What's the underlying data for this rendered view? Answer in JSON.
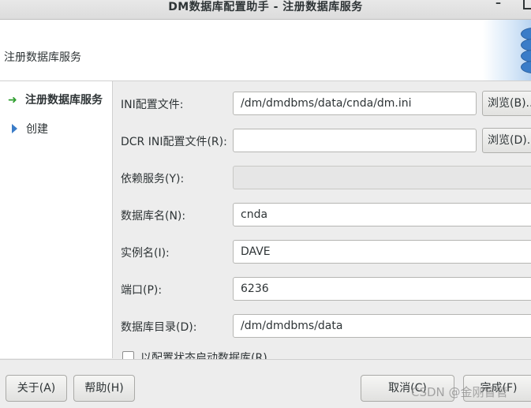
{
  "window": {
    "title": "DM数据库配置助手  -  注册数据库服务",
    "minimize_glyph": "–"
  },
  "header": {
    "title": "注册数据库服务",
    "logo_icon": "database-icon"
  },
  "sidebar": {
    "items": [
      {
        "label": "注册数据库服务",
        "icon": "arrow-right-icon",
        "active": true
      },
      {
        "label": "创建",
        "icon": "triangle-right-icon",
        "active": false
      }
    ]
  },
  "form": {
    "ini_file": {
      "label": "INI配置文件:",
      "value": "/dm/dmdbms/data/cnda/dm.ini",
      "browse_label": "浏览(B)..."
    },
    "dcr_ini_file": {
      "label": "DCR INI配置文件(R):",
      "value": "",
      "browse_label": "浏览(D)..."
    },
    "depend_service": {
      "label": "依赖服务(Y):",
      "value": ""
    },
    "db_name": {
      "label": "数据库名(N):",
      "value": "cnda"
    },
    "instance_name": {
      "label": "实例名(I):",
      "value": "DAVE"
    },
    "port": {
      "label": "端口(P):",
      "value": "6236"
    },
    "db_dir": {
      "label": "数据库目录(D):",
      "value": "/dm/dmdbms/data"
    },
    "autostart_checkbox": {
      "label": "以配置状态启动数据库(R)",
      "checked": false
    }
  },
  "buttons": {
    "about": "关于(A)",
    "help": "帮助(H)",
    "cancel": "取消(C)",
    "finish": "完成(F)"
  },
  "watermark": "CSDN @金刚冒管",
  "colors": {
    "accent_green": "#2e9e2e",
    "accent_blue": "#3a7cc8"
  }
}
